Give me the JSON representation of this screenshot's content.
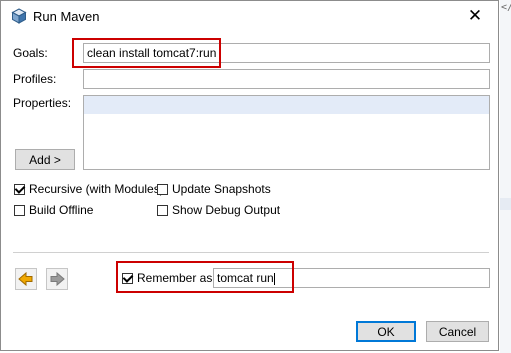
{
  "background": {
    "code_fragment": "</"
  },
  "dialog": {
    "title": "Run Maven",
    "close_glyph": "✕"
  },
  "form": {
    "goals_label": "Goals:",
    "goals_value": "clean install tomcat7:run",
    "profiles_label": "Profiles:",
    "profiles_value": "",
    "properties_label": "Properties:",
    "add_button_label": "Add >"
  },
  "options": {
    "recursive": {
      "label": "Recursive (with Modules)",
      "checked": true
    },
    "update_snapshots": {
      "label": "Update Snapshots",
      "checked": false
    },
    "build_offline": {
      "label": "Build Offline",
      "checked": false
    },
    "show_debug_output": {
      "label": "Show Debug Output",
      "checked": false
    }
  },
  "remember": {
    "label": "Remember as:",
    "checked": true,
    "value": "tomcat run"
  },
  "buttons": {
    "ok": "OK",
    "cancel": "Cancel"
  },
  "colors": {
    "highlight": "#cc0000",
    "default_button_border": "#0078d7",
    "selection_row": "#e3ebf8",
    "nav_arrow_active": "#f0a800",
    "nav_arrow_disabled": "#9a9a9a"
  },
  "icons": {
    "title": "maven-cube-icon",
    "back": "arrow-left-icon",
    "forward": "arrow-right-icon"
  }
}
